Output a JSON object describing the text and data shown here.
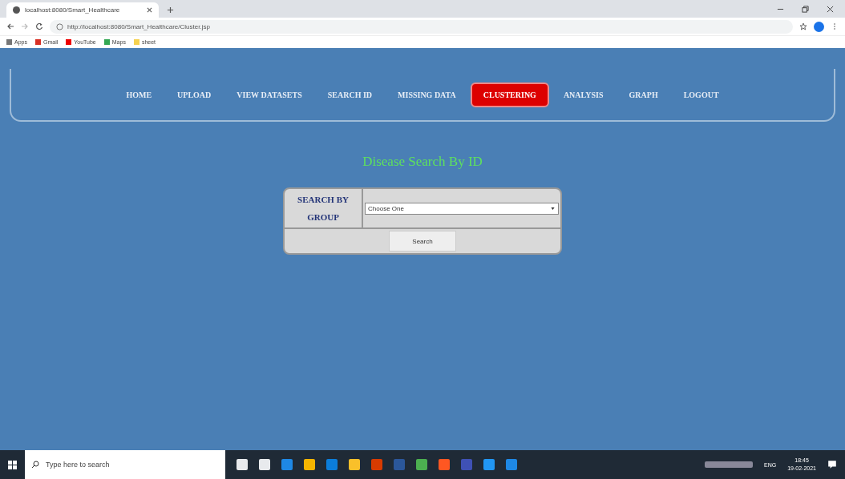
{
  "browser": {
    "tab_title": "localhost:8080/Smart_Healthcare",
    "url": "http://localhost:8080/Smart_Healthcare/Cluster.jsp",
    "bookmarks": [
      "Apps",
      "Gmail",
      "YouTube",
      "Maps",
      "sheet"
    ]
  },
  "nav": [
    {
      "label": "HOME",
      "selected": false
    },
    {
      "label": "UPLOAD",
      "selected": false
    },
    {
      "label": "VIEW DATASETS",
      "selected": false
    },
    {
      "label": "SEARCH ID",
      "selected": false
    },
    {
      "label": "MISSING DATA",
      "selected": false
    },
    {
      "label": "CLUSTERING",
      "selected": true
    },
    {
      "label": "ANALYSIS",
      "selected": false
    },
    {
      "label": "GRAPH",
      "selected": false
    },
    {
      "label": "LOGOUT",
      "selected": false
    }
  ],
  "heading": "Disease Search By ID",
  "form": {
    "label": "SEARCH BY GROUP",
    "select_value": "Choose One",
    "button": "Search"
  },
  "taskbar": {
    "search_placeholder": "Type here to search",
    "language": "ENG",
    "time": "18:45",
    "date": "19-02-2021"
  }
}
